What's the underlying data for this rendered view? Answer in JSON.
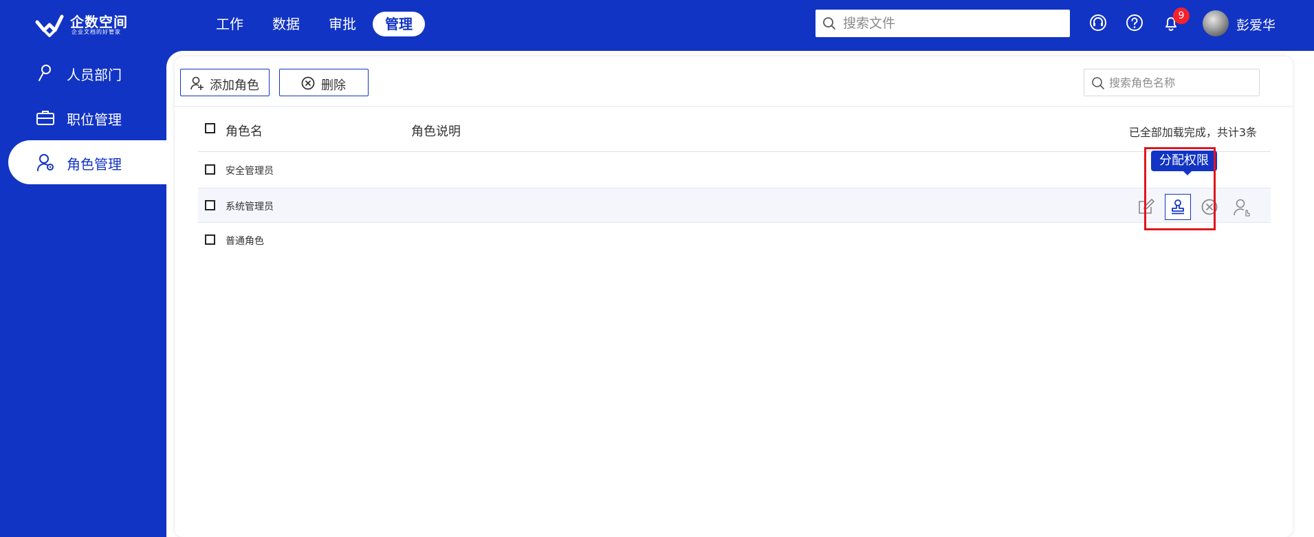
{
  "app": {
    "logo_title": "企数空间",
    "logo_subtitle": "企业文档的好管家",
    "brand_color": "#1234c4"
  },
  "topnav": {
    "items": [
      {
        "label": "工作",
        "active": false
      },
      {
        "label": "数据",
        "active": false
      },
      {
        "label": "审批",
        "active": false
      },
      {
        "label": "管理",
        "active": true
      }
    ]
  },
  "header": {
    "search_placeholder": "搜索文件",
    "icons": [
      "headset-icon",
      "help-icon",
      "bell-icon"
    ],
    "notification_count": "9",
    "username": "彭爱华"
  },
  "sidebar": {
    "items": [
      {
        "label": "人员部门",
        "icon": "user-icon",
        "active": false
      },
      {
        "label": "职位管理",
        "icon": "briefcase-icon",
        "active": false
      },
      {
        "label": "角色管理",
        "icon": "user-role-icon",
        "active": true
      }
    ]
  },
  "toolbar": {
    "add_label": "添加角色",
    "delete_label": "删除",
    "search_placeholder": "搜索角色名称"
  },
  "table": {
    "columns": [
      "角色名",
      "角色说明"
    ],
    "status": "已全部加载完成，共计3条",
    "rows": [
      {
        "name": "安全管理员",
        "description": ""
      },
      {
        "name": "系统管理员",
        "description": ""
      },
      {
        "name": "普通角色",
        "description": ""
      }
    ],
    "hover_row_actions": [
      "edit-icon",
      "stamp-icon",
      "close-circle-icon",
      "user-hand-icon"
    ]
  },
  "tooltip": {
    "text": "分配权限"
  },
  "highlight_color": "#e0161c"
}
